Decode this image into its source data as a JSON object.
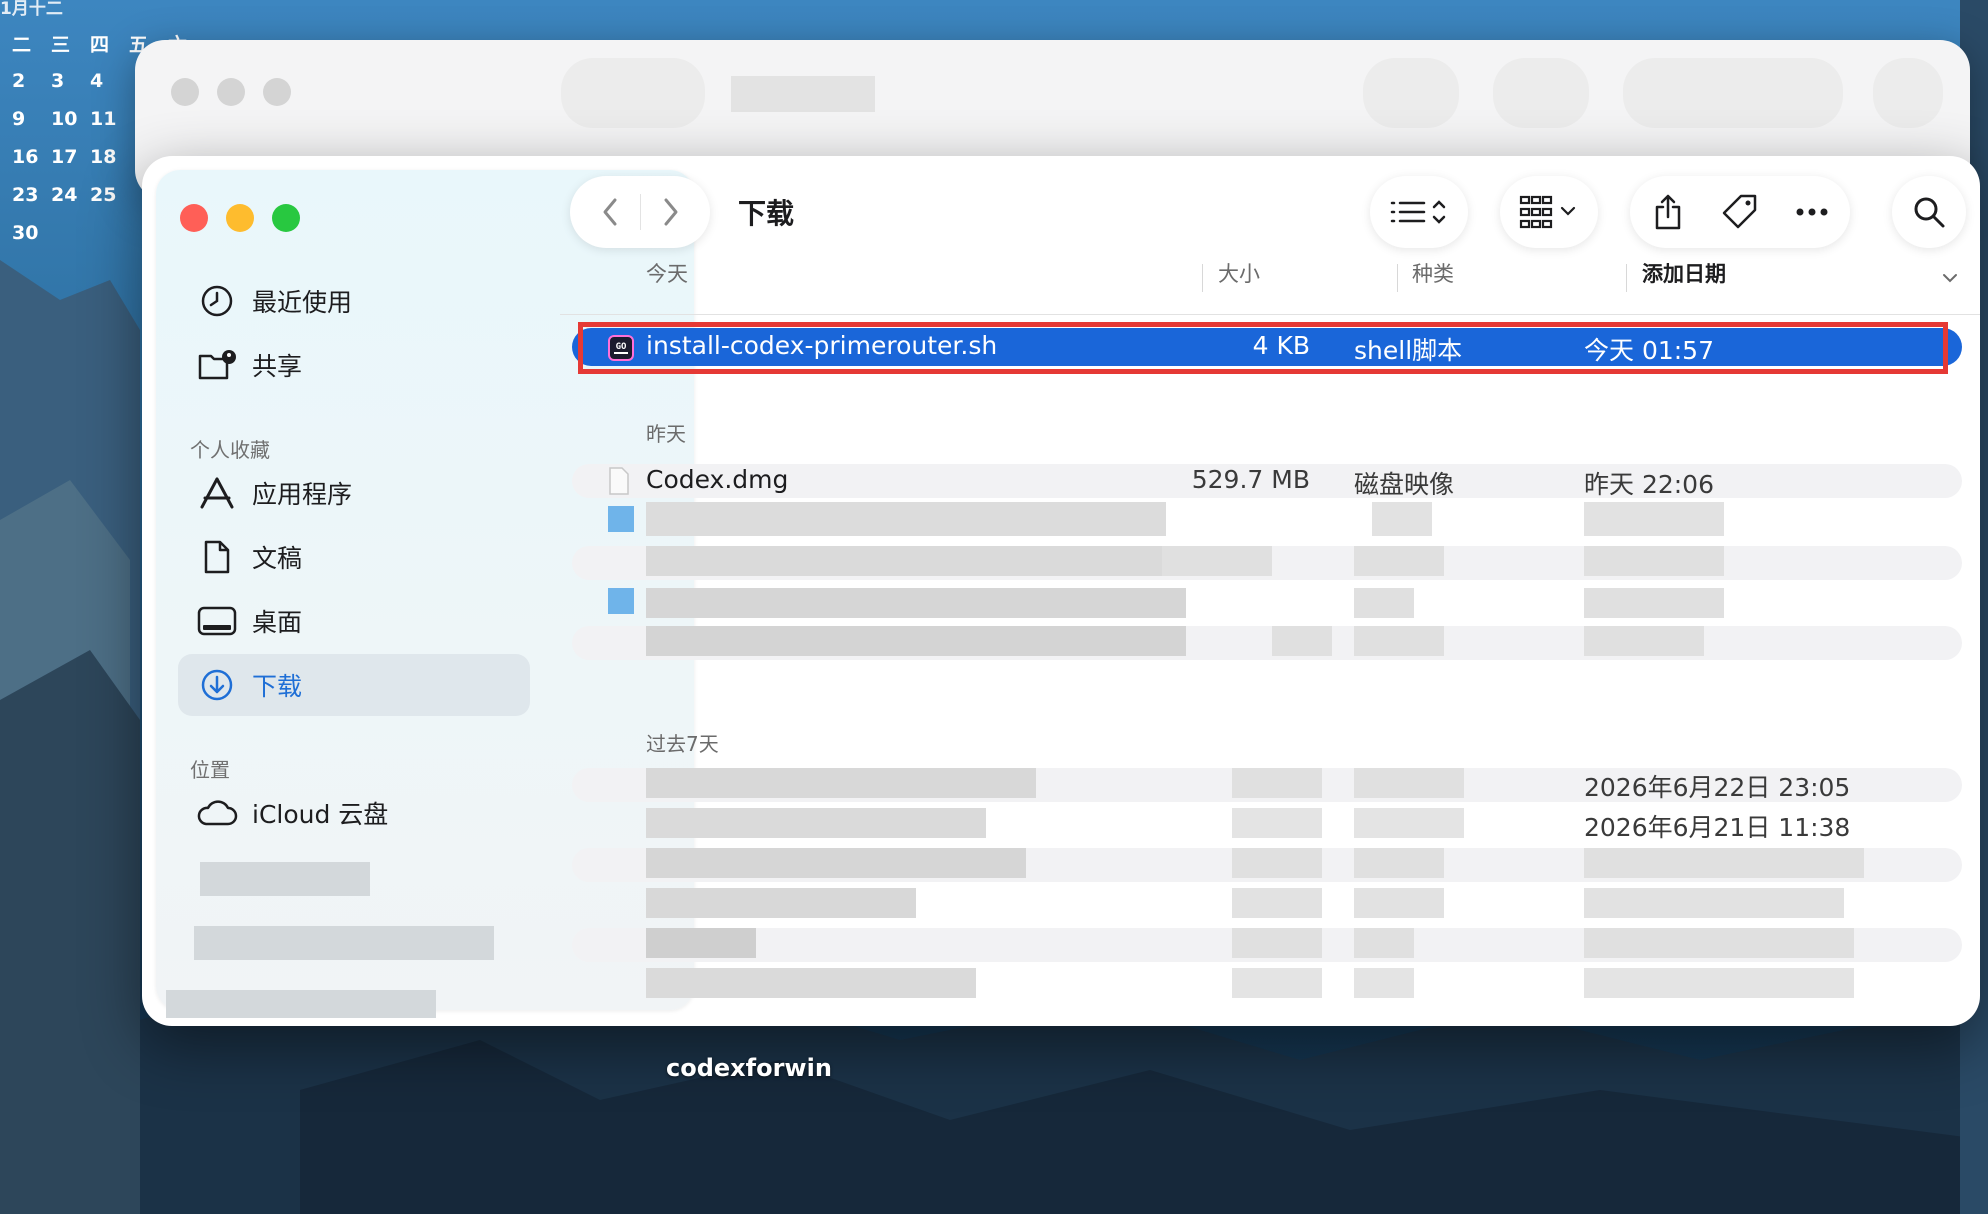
{
  "calendar": {
    "title": "1月十二",
    "weekdays": [
      "二",
      "三",
      "四",
      "五",
      "六"
    ],
    "rows": [
      [
        "2",
        "3",
        "4"
      ],
      [
        "9",
        "10",
        "11"
      ],
      [
        "16",
        "17",
        "18"
      ],
      [
        "23",
        "24",
        "25"
      ],
      [
        "30"
      ]
    ]
  },
  "window": {
    "title": "下载",
    "traffic_lights": {
      "close": "#ff5f57",
      "minimize": "#febc2e",
      "zoom": "#28c840"
    }
  },
  "sidebar": {
    "items_top": [
      {
        "label": "最近使用",
        "icon": "clock-icon"
      },
      {
        "label": "共享",
        "icon": "shared-folder-icon"
      }
    ],
    "section_favorites": "个人收藏",
    "favorites": [
      {
        "label": "应用程序",
        "icon": "applications-icon"
      },
      {
        "label": "文稿",
        "icon": "document-icon"
      },
      {
        "label": "桌面",
        "icon": "desktop-icon"
      },
      {
        "label": "下载",
        "icon": "download-icon",
        "active": true
      }
    ],
    "section_locations": "位置",
    "locations": [
      {
        "label": "iCloud 云盘",
        "icon": "cloud-icon"
      }
    ]
  },
  "columns": {
    "name": "今天",
    "size": "大小",
    "kind": "种类",
    "date_added": "添加日期"
  },
  "groups": {
    "today": "今天",
    "yesterday": "昨天",
    "past7": "过去7天"
  },
  "files": {
    "selected": {
      "name": "install-codex-primerouter.sh",
      "size": "4 KB",
      "kind": "shell脚本",
      "date": "今天 01:57"
    },
    "yesterday_first": {
      "name": "Codex.dmg",
      "size": "529.7 MB",
      "kind": "磁盘映像",
      "date": "昨天 22:06"
    },
    "past7_dates": [
      "2026年6月22日 23:05",
      "2026年6月21日 11:38"
    ]
  },
  "desktop": {
    "folder_label": "codexforwin"
  },
  "colors": {
    "accent": "#1a66d9",
    "highlight_box": "#e53935"
  }
}
